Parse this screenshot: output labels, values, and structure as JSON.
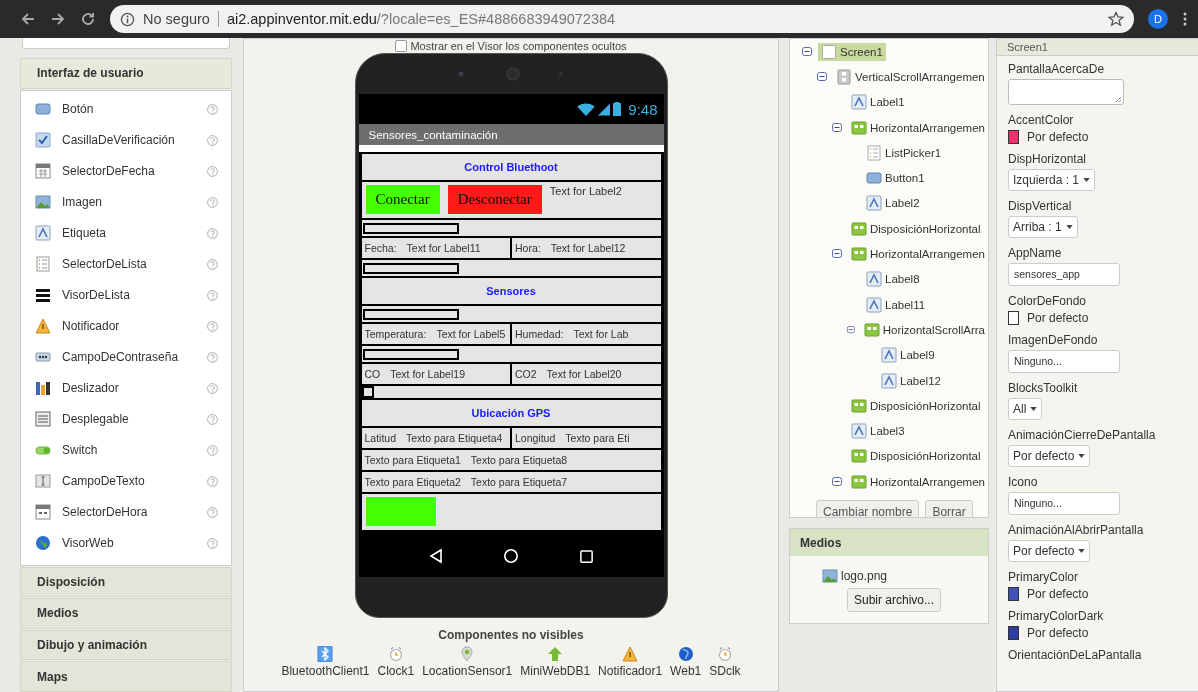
{
  "browser": {
    "security": "No seguro",
    "host": "ai2.appinventor.mit.edu",
    "path": "/?locale=es_ES#4886683949072384",
    "avatar": "D"
  },
  "palette": {
    "sections": [
      {
        "title": "Interfaz de usuario",
        "expanded": true,
        "items": [
          "Botón",
          "CasillaDeVerificación",
          "SelectorDeFecha",
          "Imagen",
          "Etiqueta",
          "SelectorDeLista",
          "VisorDeLista",
          "Notificador",
          "CampoDeContraseña",
          "Deslizador",
          "Desplegable",
          "Switch",
          "CampoDeTexto",
          "SelectorDeHora",
          "VisorWeb"
        ]
      },
      {
        "title": "Disposición",
        "expanded": false
      },
      {
        "title": "Medios",
        "expanded": false
      },
      {
        "title": "Dibujo y animación",
        "expanded": false
      },
      {
        "title": "Maps",
        "expanded": false
      }
    ]
  },
  "viewer": {
    "hidden_toggle": {
      "label": "Mostrar en el Visor los componentes ocultos",
      "checked": false
    },
    "phone": {
      "time": "9:48",
      "title": "Sensores_contaminación",
      "rows": [
        {
          "kind": "heading",
          "text": "Control Bluethoot"
        },
        {
          "kind": "buttons",
          "buttons": [
            {
              "text": "Conectar",
              "color": "#44ff00"
            },
            {
              "text": "Desconectar",
              "color": "#ff1a1a"
            }
          ],
          "label": "Text for Label2"
        },
        {
          "kind": "blank"
        },
        {
          "kind": "pairs",
          "cells": [
            [
              "Fecha:",
              "Text for Label11"
            ],
            [
              "Hora:",
              "Text for Label12"
            ]
          ]
        },
        {
          "kind": "blank"
        },
        {
          "kind": "heading",
          "text": "Sensores"
        },
        {
          "kind": "blank"
        },
        {
          "kind": "pairs",
          "cells": [
            [
              "Temperatura:",
              "Text for Label5"
            ],
            [
              "Humedad:",
              "Text for Lab"
            ]
          ]
        },
        {
          "kind": "blank"
        },
        {
          "kind": "pairs",
          "cells": [
            [
              "CO",
              "Text for Label19"
            ],
            [
              "CO2",
              "Text for Label20"
            ]
          ]
        },
        {
          "kind": "square"
        },
        {
          "kind": "heading",
          "text": "Ubicación GPS"
        },
        {
          "kind": "pairs",
          "cells": [
            [
              "Latitud",
              "Texto para Etiqueta4"
            ],
            [
              "Longitud",
              "Texto para Eti"
            ]
          ]
        },
        {
          "kind": "pairs",
          "cells": [
            [
              "Texto para Etiqueta1",
              "Texto para Etiqueta8"
            ]
          ]
        },
        {
          "kind": "pairs",
          "cells": [
            [
              "Texto para Etiqueta2",
              "Texto para Etiqueta7"
            ]
          ]
        },
        {
          "kind": "buttons",
          "buttons": [
            {
              "color": "#44ff00"
            }
          ]
        }
      ]
    },
    "nonvisible": {
      "title": "Componentes no visibles",
      "items": [
        {
          "name": "BluetoothClient1",
          "kind": "bluetooth"
        },
        {
          "name": "Clock1",
          "kind": "clock"
        },
        {
          "name": "LocationSensor1",
          "kind": "location"
        },
        {
          "name": "MiniWebDB1",
          "kind": "database"
        },
        {
          "name": "Notificador1",
          "kind": "notifier"
        },
        {
          "name": "Web1",
          "kind": "web"
        },
        {
          "name": "SDclk",
          "kind": "clock"
        }
      ]
    }
  },
  "tree": {
    "nodes": [
      {
        "name": "Screen1",
        "kind": "screen",
        "selected": true,
        "expanded": true,
        "children": [
          {
            "name": "VerticalScrollArrangemen",
            "kind": "vertical",
            "selected": false,
            "expanded": true,
            "children": [
              {
                "name": "Label1",
                "kind": "label",
                "selected": false
              },
              {
                "name": "HorizontalArrangemen",
                "kind": "arrangement",
                "selected": false,
                "expanded": true,
                "children": [
                  {
                    "name": "ListPicker1",
                    "kind": "listpicker",
                    "selected": false
                  },
                  {
                    "name": "Button1",
                    "kind": "button",
                    "selected": false
                  },
                  {
                    "name": "Label2",
                    "kind": "label",
                    "selected": false
                  }
                ]
              },
              {
                "name": "DisposiciónHorizontal",
                "kind": "arrangement",
                "selected": false
              },
              {
                "name": "HorizontalArrangemen",
                "kind": "arrangement",
                "selected": false,
                "expanded": true,
                "children": [
                  {
                    "name": "Label8",
                    "kind": "label",
                    "selected": false
                  },
                  {
                    "name": "Label11",
                    "kind": "label",
                    "selected": false
                  },
                  {
                    "name": "HorizontalScrollArra",
                    "kind": "arrangement",
                    "selected": false,
                    "expanded": true,
                    "children": [
                      {
                        "name": "Label9",
                        "kind": "label",
                        "selected": false
                      },
                      {
                        "name": "Label12",
                        "kind": "label",
                        "selected": false
                      }
                    ]
                  }
                ]
              },
              {
                "name": "DisposiciónHorizontal",
                "kind": "arrangement",
                "selected": false
              },
              {
                "name": "Label3",
                "kind": "label",
                "selected": false
              },
              {
                "name": "DisposiciónHorizontal",
                "kind": "arrangement",
                "selected": false
              },
              {
                "name": "HorizontalArrangemen",
                "kind": "arrangement",
                "selected": false,
                "expanded": true
              }
            ]
          }
        ]
      }
    ],
    "buttons": [
      "Cambiar nombre",
      "Borrar"
    ]
  },
  "media": {
    "title": "Medios",
    "files": [
      "logo.png"
    ],
    "upload": "Subir archivo..."
  },
  "properties": {
    "title": "Screen1",
    "items": [
      {
        "label": "PantallaAcercaDe",
        "kind": "textarea"
      },
      {
        "label": "AccentColor",
        "kind": "color",
        "color": "#f0326a",
        "value": "Por defecto"
      },
      {
        "label": "DispHorizontal",
        "kind": "select",
        "value": "Izquierda : 1"
      },
      {
        "label": "DispVertical",
        "kind": "select",
        "value": "Arriba : 1"
      },
      {
        "label": "AppName",
        "kind": "text",
        "value": "sensores_app"
      },
      {
        "label": "ColorDeFondo",
        "kind": "color",
        "color": "#ffffff",
        "value": "Por defecto"
      },
      {
        "label": "ImagenDeFondo",
        "kind": "text",
        "value": "Ninguno..."
      },
      {
        "label": "BlocksToolkit",
        "kind": "select",
        "value": "All"
      },
      {
        "label": "AnimaciónCierreDePantalla",
        "kind": "select",
        "value": "Por defecto"
      },
      {
        "label": "Icono",
        "kind": "text",
        "value": "Ninguno..."
      },
      {
        "label": "AnimaciónAlAbrirPantalla",
        "kind": "select",
        "value": "Por defecto"
      },
      {
        "label": "PrimaryColor",
        "kind": "color",
        "color": "#3f51b5",
        "value": "Por defecto"
      },
      {
        "label": "PrimaryColorDark",
        "kind": "color",
        "color": "#303f9f",
        "value": "Por defecto"
      },
      {
        "label": "OrientaciónDeLaPantalla",
        "kind": "select"
      }
    ]
  }
}
